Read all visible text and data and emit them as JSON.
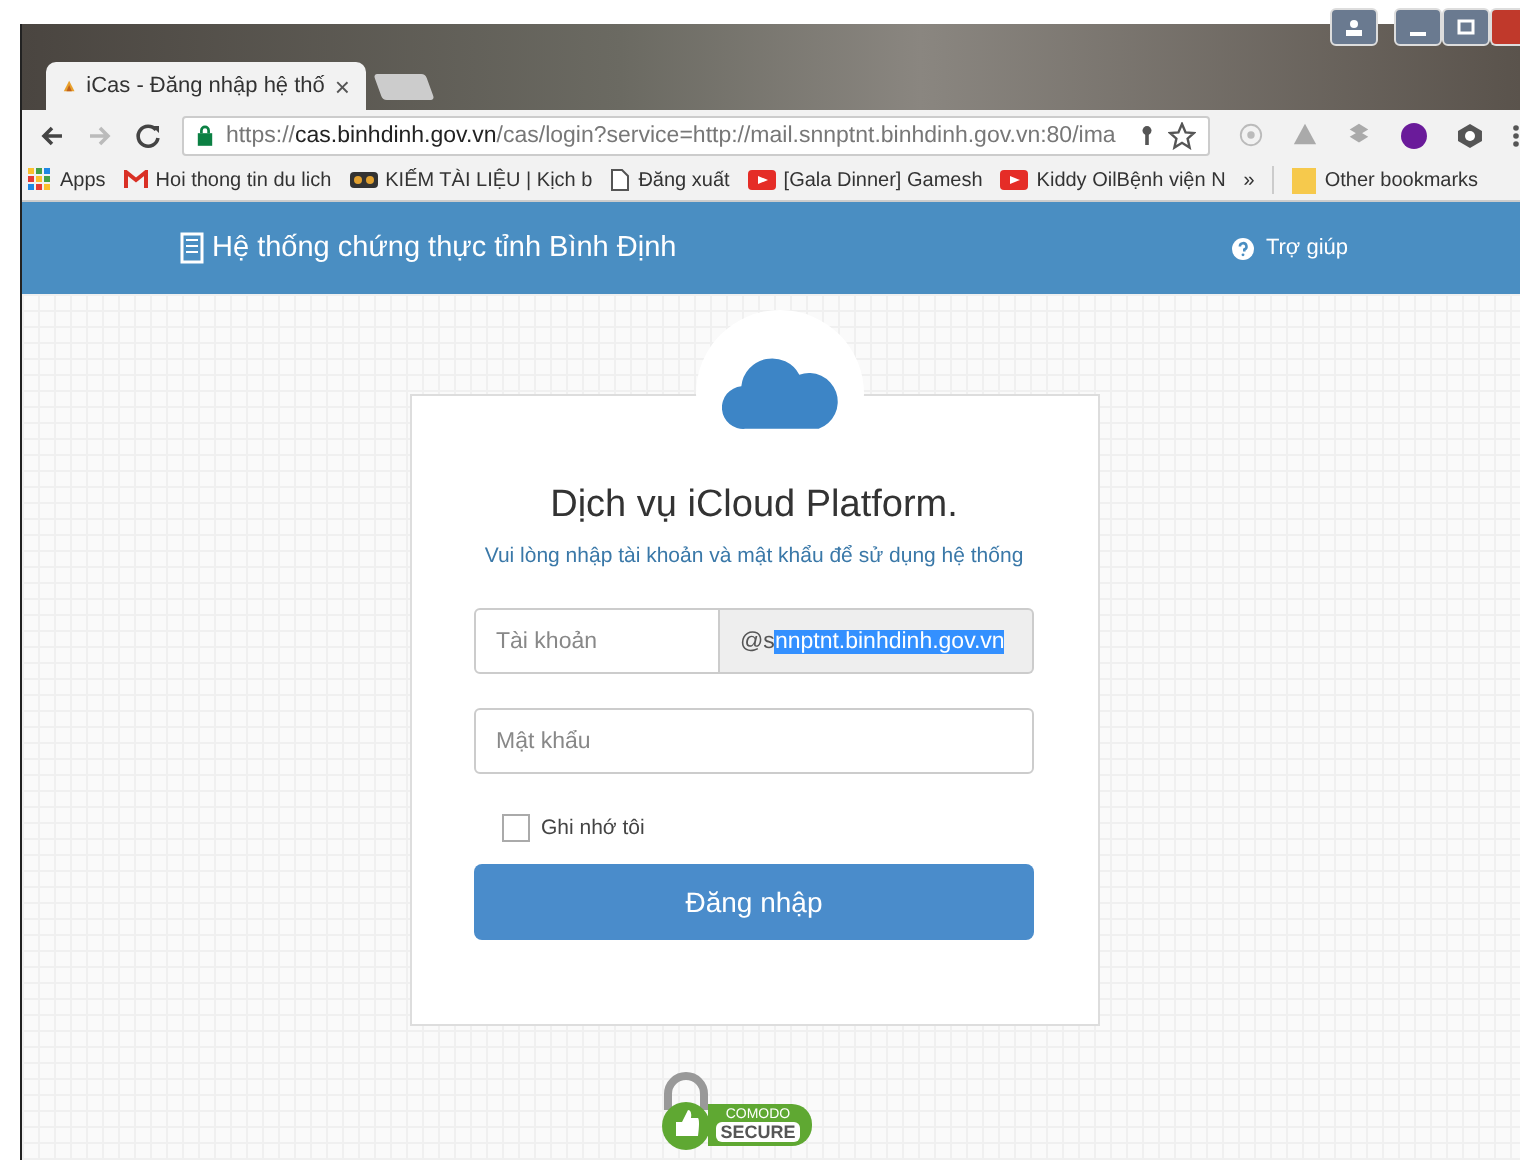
{
  "browser": {
    "tab": {
      "title": "iCas - Đăng nhập hệ thố",
      "close": "×",
      "selected": true
    },
    "url": [
      {
        "text": "https://",
        "emphasis": false
      },
      {
        "text": "cas.binhdinh.gov.vn",
        "emphasis": true
      },
      {
        "text": "/cas/login?service=http://mail.snnptnt.binhdinh.gov.vn:80/ima",
        "emphasis": false
      }
    ],
    "bookmarks": [
      {
        "kind": "apps",
        "label": "Apps"
      },
      {
        "kind": "gmail",
        "label": "Hoi thong tin du lich"
      },
      {
        "kind": "book",
        "label": "KIẾM TÀI LIỆU | Kịch b"
      },
      {
        "kind": "page",
        "label": "Đăng xuất"
      },
      {
        "kind": "video",
        "label": "[Gala Dinner] Gamesh"
      },
      {
        "kind": "video",
        "label": "Kiddy OilBệnh viện N"
      },
      {
        "kind": "more",
        "label": "»"
      },
      {
        "kind": "folder",
        "label": "Other bookmarks"
      }
    ]
  },
  "header": {
    "title": "Hệ thống chứng thực tỉnh Bình Định",
    "help": "Trợ giúp"
  },
  "login": {
    "title": "Dịch vụ iCloud Platform.",
    "subtitle": "Vui lòng nhập tài khoản và mật khẩu để sử dụng hệ thống",
    "username": {
      "placeholder": "Tài khoản"
    },
    "domain": [
      {
        "text": "@s",
        "selected": false
      },
      {
        "text": "nnptnt.binhdinh.gov.vn",
        "selected": true
      }
    ],
    "password": {
      "placeholder": "Mật khẩu"
    },
    "remember": {
      "label": "Ghi nhớ tôi",
      "checked": false
    },
    "submit": "Đăng nhập"
  },
  "badge": {
    "top": "COMODO",
    "bottom": "SECURE"
  }
}
